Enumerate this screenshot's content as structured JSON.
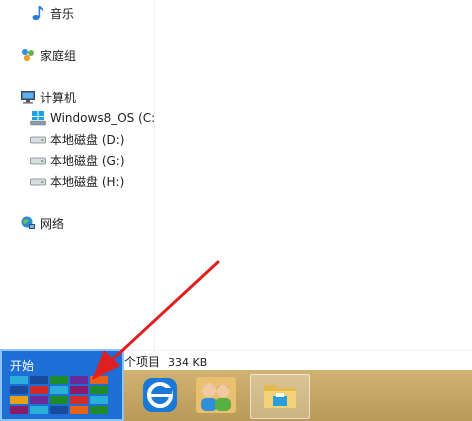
{
  "nav": {
    "music": "音乐",
    "homegroup": "家庭组",
    "computer": "计算机",
    "drive_c": "Windows8_OS (C:)",
    "drive_d": "本地磁盘 (D:)",
    "drive_g": "本地磁盘 (G:)",
    "drive_h": "本地磁盘 (H:)",
    "network": "网络"
  },
  "status": {
    "items": "个项目",
    "size": "334 KB"
  },
  "start": {
    "label": "开始"
  },
  "colors": {
    "start_blue": "#1d6fd6",
    "taskbar": "#c2a362",
    "arrow": "#e02020"
  },
  "icons": {
    "music": "music-note-icon",
    "homegroup": "homegroup-icon",
    "computer": "computer-icon",
    "drive_os": "windows-drive-icon",
    "drive": "hard-drive-icon",
    "network": "network-icon",
    "ie": "internet-explorer-icon",
    "people": "people-icon",
    "explorer": "file-explorer-icon"
  }
}
